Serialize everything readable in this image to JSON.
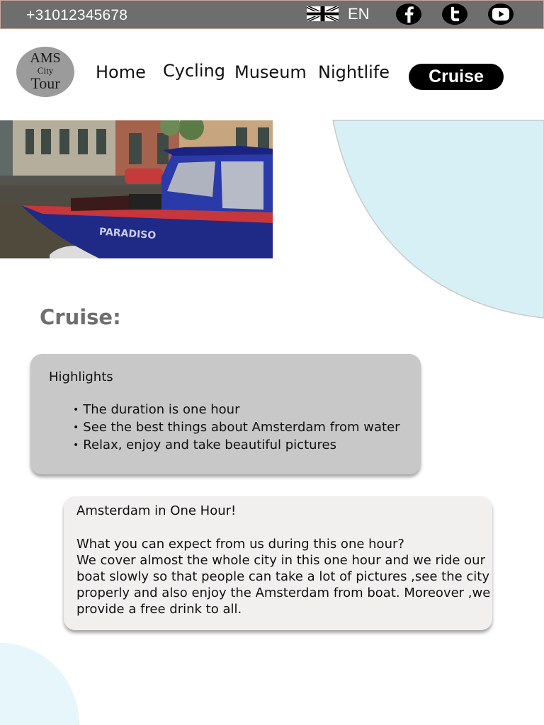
{
  "topbar": {
    "phone": "+31012345678",
    "language": "EN",
    "flag_icon": "uk-flag-icon",
    "social": [
      "facebook-icon",
      "twitter-icon",
      "youtube-icon"
    ]
  },
  "logo": {
    "line1": "AMS",
    "line2": "City",
    "line3": "Tour"
  },
  "nav": {
    "items": [
      {
        "label": "Home"
      },
      {
        "label": "Cycling"
      },
      {
        "label": "Museum"
      },
      {
        "label": "Nightlife"
      },
      {
        "label": "Cruise",
        "active": true
      }
    ]
  },
  "hero": {
    "boat_name": "PARADISO"
  },
  "page": {
    "title": "Cruise:"
  },
  "highlights": {
    "title": "Highlights",
    "items": [
      "The duration is one hour",
      "See the best things about Amsterdam from water",
      "Relax, enjoy and take beautiful pictures"
    ]
  },
  "info": {
    "heading": "Amsterdam in One Hour!",
    "lines": [
      "What you can expect from us during this one hour?",
      "We cover almost the whole city in this one hour and we ride our",
      "boat slowly so that people can take a lot of pictures ,see the city",
      "properly and also enjoy the Amsterdam from boat. Moreover ,we",
      "provide a free drink to all."
    ]
  },
  "colors": {
    "topbar": "#6e6e6e",
    "accent_blue": "#d6f0f6",
    "highlight_card": "#c8c8c8",
    "info_card": "#f2efef",
    "active_nav": "#000000"
  }
}
